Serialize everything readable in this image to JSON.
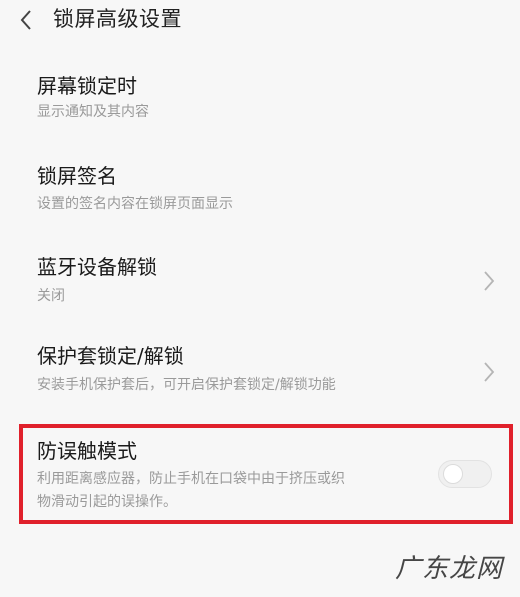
{
  "header": {
    "title": "锁屏高级设置"
  },
  "items": [
    {
      "title": "屏幕锁定时",
      "subtitle": "显示通知及其内容"
    },
    {
      "title": "锁屏签名",
      "subtitle": "设置的签名内容在锁屏页面显示"
    },
    {
      "title": "蓝牙设备解锁",
      "subtitle": "关闭"
    },
    {
      "title": "保护套锁定/解锁",
      "subtitle": "安装手机保护套后，可开启保护套锁定/解锁功能"
    },
    {
      "title": "防误触模式",
      "subtitle_line1": "利用距离感应器，防止手机在口袋中由于挤压或织",
      "subtitle_line2": "物滑动引起的误操作。",
      "toggle_on": false
    }
  ],
  "watermark": "广东龙网",
  "colors": {
    "background": "#f7f7f7",
    "highlight_border": "#e0202b",
    "subtitle_text": "#9a9a9a"
  },
  "icons": {
    "back": "chevron-left-icon",
    "arrow": "chevron-right-icon"
  }
}
